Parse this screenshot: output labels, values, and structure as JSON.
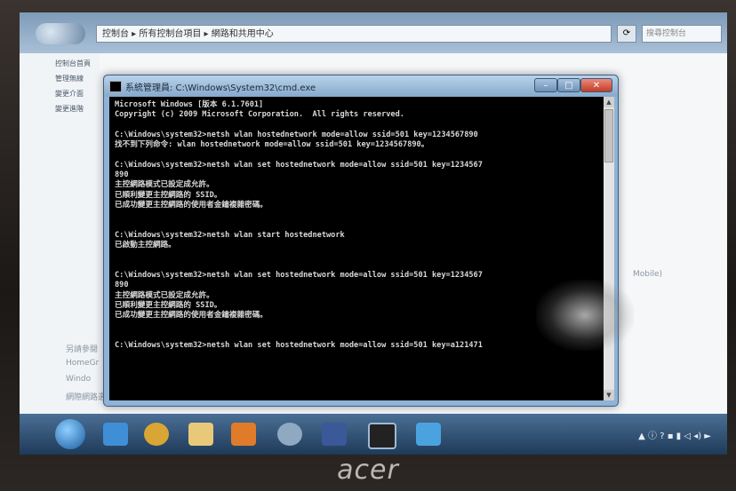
{
  "explorer": {
    "address": "控制台 ▸ 所有控制台項目 ▸ 網路和共用中心",
    "search_placeholder": "搜尋控制台",
    "left_pane": [
      "控制台首頁",
      "管理無線",
      "變更介面",
      "變更進階"
    ],
    "side_labels": [
      "另請參閱",
      "HomeGr",
      "Windo",
      "網際網路選項"
    ],
    "right_text": "Mobile)"
  },
  "cmd_window": {
    "title": "系統管理員: C:\\Windows\\System32\\cmd.exe",
    "lines": [
      "Microsoft Windows [版本 6.1.7601]",
      "Copyright (c) 2009 Microsoft Corporation.  All rights reserved.",
      "",
      "C:\\Windows\\system32>netsh wlan hostednetwork mode=allow ssid=501 key=1234567890",
      "找不到下列命令: wlan hostednetwork mode=allow ssid=501 key=1234567890。",
      "",
      "C:\\Windows\\system32>netsh wlan set hostednetwork mode=allow ssid=501 key=1234567",
      "890",
      "主控網路模式已設定成允許。",
      "已順利變更主控網路的 SSID。",
      "已成功變更主控網路的使用者金鑰複雜密碼。",
      "",
      "",
      "C:\\Windows\\system32>netsh wlan start hostednetwork",
      "已啟動主控網路。",
      "",
      "",
      "C:\\Windows\\system32>netsh wlan set hostednetwork mode=allow ssid=501 key=1234567",
      "890",
      "主控網路模式已設定成允許。",
      "已順利變更主控網路的 SSID。",
      "已成功變更主控網路的使用者金鑰複雜密碼。",
      "",
      "",
      "C:\\Windows\\system32>netsh wlan set hostednetwork mode=allow ssid=501 key=a121471"
    ]
  },
  "taskbar": {
    "icons": [
      "start-orb-icon",
      "ie-icon",
      "chrome-icon",
      "folder-icon",
      "media-player-icon",
      "network-icon",
      "facebook-icon",
      "cmd-icon",
      "monitor-icon"
    ],
    "tray": "▲ ⓘ ? ▪ ▮ ◁ ◂) ►"
  },
  "brand": "acer",
  "colors": {
    "console_bg": "#000000",
    "console_text": "#d8d8d8",
    "taskbar": "#2b4a6e"
  }
}
